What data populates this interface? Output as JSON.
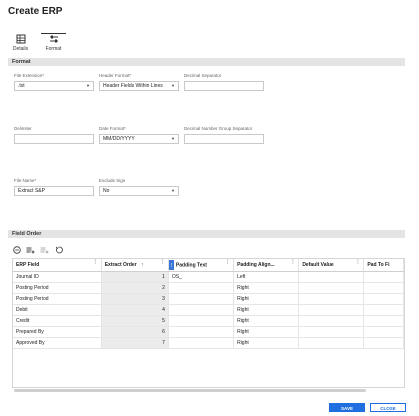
{
  "page": {
    "title": "Create ERP"
  },
  "tabs": [
    {
      "label": "Details",
      "icon": "list-grid-icon"
    },
    {
      "label": "Format",
      "icon": "sliders-icon"
    }
  ],
  "format_section": {
    "title": "Format",
    "fields": {
      "file_extension": {
        "label": "File Extension*",
        "value": ".txt"
      },
      "header_format": {
        "label": "Header Format*",
        "value": "Header Fields Within Lines"
      },
      "decimal_separator": {
        "label": "Decimal Separator",
        "value": ""
      },
      "delimiter": {
        "label": "Delimiter",
        "value": ""
      },
      "date_format": {
        "label": "Date Format*",
        "value": "MM/DD/YYYY"
      },
      "decimal_group_separator": {
        "label": "Decimal Number Group Separator",
        "value": ""
      },
      "file_name": {
        "label": "File Name*",
        "value": "Extract S&P"
      },
      "exclude_sign": {
        "label": "Exclude Sign",
        "value": "No"
      }
    }
  },
  "field_order_section": {
    "title": "Field Order",
    "columns": [
      "ERP Field",
      "Extract Order",
      "Padding Text",
      "Padding Align...",
      "Default Value",
      "Pad To Fi"
    ],
    "sort_indicator": "↑",
    "rows": [
      {
        "erp_field": "Journal ID",
        "extract_order": "1",
        "padding_text": "OS_",
        "padding_align": "Left",
        "default_value": "",
        "pad_to": ""
      },
      {
        "erp_field": "Posting Period",
        "extract_order": "2",
        "padding_text": "",
        "padding_align": "Right",
        "default_value": "",
        "pad_to": ""
      },
      {
        "erp_field": "Posting Period",
        "extract_order": "3",
        "padding_text": "",
        "padding_align": "Right",
        "default_value": "",
        "pad_to": ""
      },
      {
        "erp_field": "Debit",
        "extract_order": "4",
        "padding_text": "",
        "padding_align": "Right",
        "default_value": "",
        "pad_to": ""
      },
      {
        "erp_field": "Credit",
        "extract_order": "5",
        "padding_text": "",
        "padding_align": "Right",
        "default_value": "",
        "pad_to": ""
      },
      {
        "erp_field": "Prepared By",
        "extract_order": "6",
        "padding_text": "",
        "padding_align": "Right",
        "default_value": "",
        "pad_to": ""
      },
      {
        "erp_field": "Approved By",
        "extract_order": "7",
        "padding_text": "",
        "padding_align": "Right",
        "default_value": "",
        "pad_to": ""
      }
    ]
  },
  "buttons": {
    "save": "SAVE",
    "close": "CLOSE"
  },
  "colors": {
    "primary": "#1f6fe0",
    "section_bg": "#e4e4e4",
    "order_col_bg": "#ebebeb"
  }
}
